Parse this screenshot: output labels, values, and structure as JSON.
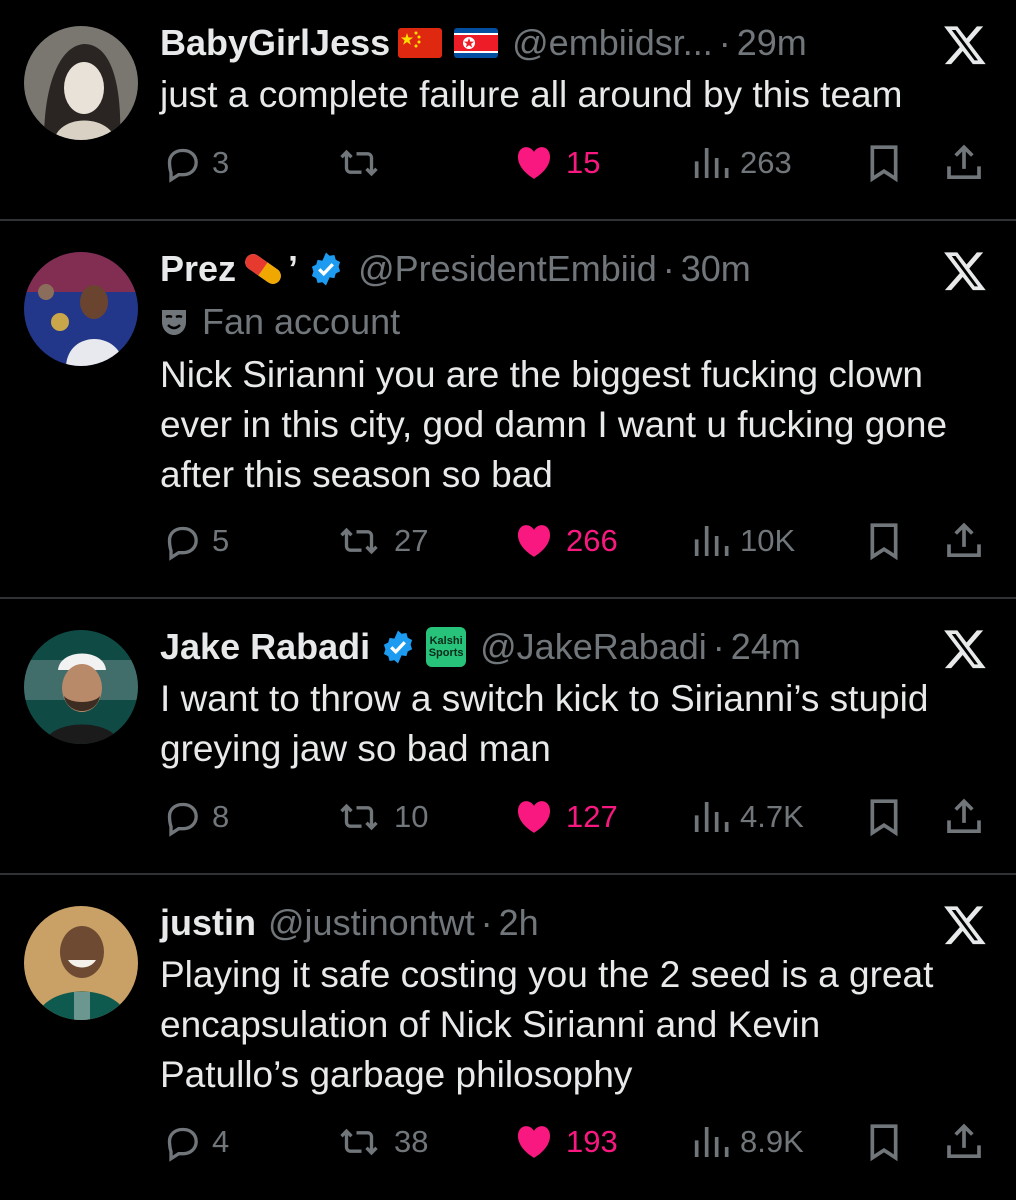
{
  "tweets": [
    {
      "name": "BabyGirlJess",
      "handle": "@embiidsr...",
      "dot": "·",
      "time": "29m",
      "badges": [
        "flag-china-icon",
        "flag-north-korea-icon"
      ],
      "lines": [
        "just a complete failure all around by this team"
      ],
      "replies": "3",
      "retweets": "",
      "likes": "15",
      "views": "263"
    },
    {
      "name": "Prez",
      "name_suffix": "’",
      "handle": "@PresidentEmbiid",
      "dot": "·",
      "time": "30m",
      "badges": [
        "pill-icon",
        "verified-icon"
      ],
      "label": "Fan account",
      "lines": [
        "Nick Sirianni you are the biggest fucking clown",
        "ever in this city, god damn I want u fucking gone",
        "after this season so bad"
      ],
      "replies": "5",
      "retweets": "27",
      "likes": "266",
      "views": "10K"
    },
    {
      "name": "Jake Rabadi",
      "handle": "@JakeRabadi",
      "dot": "·",
      "time": "24m",
      "badges": [
        "verified-icon",
        "kalshi-sports-logo"
      ],
      "affiliate": {
        "line1": "Kalshi",
        "line2": "Sports"
      },
      "lines": [
        "I want to throw a switch kick to Sirianni’s stupid",
        "greying jaw so bad man"
      ],
      "replies": "8",
      "retweets": "10",
      "likes": "127",
      "views": "4.7K"
    },
    {
      "name": "justin",
      "handle": "@justinontwt",
      "dot": "·",
      "time": "2h",
      "lines": [
        "Playing it safe costing you the 2 seed is a great",
        "encapsulation of Nick Sirianni and Kevin",
        "Patullo’s garbage philosophy"
      ],
      "replies": "4",
      "retweets": "38",
      "likes": "193",
      "views": "8.9K"
    }
  ],
  "colors": {
    "background": "#000000",
    "text": "#e7e9ea",
    "muted": "#71767b",
    "like": "#f91880",
    "verified": "#1d9bf0",
    "divider": "#2f3336"
  }
}
